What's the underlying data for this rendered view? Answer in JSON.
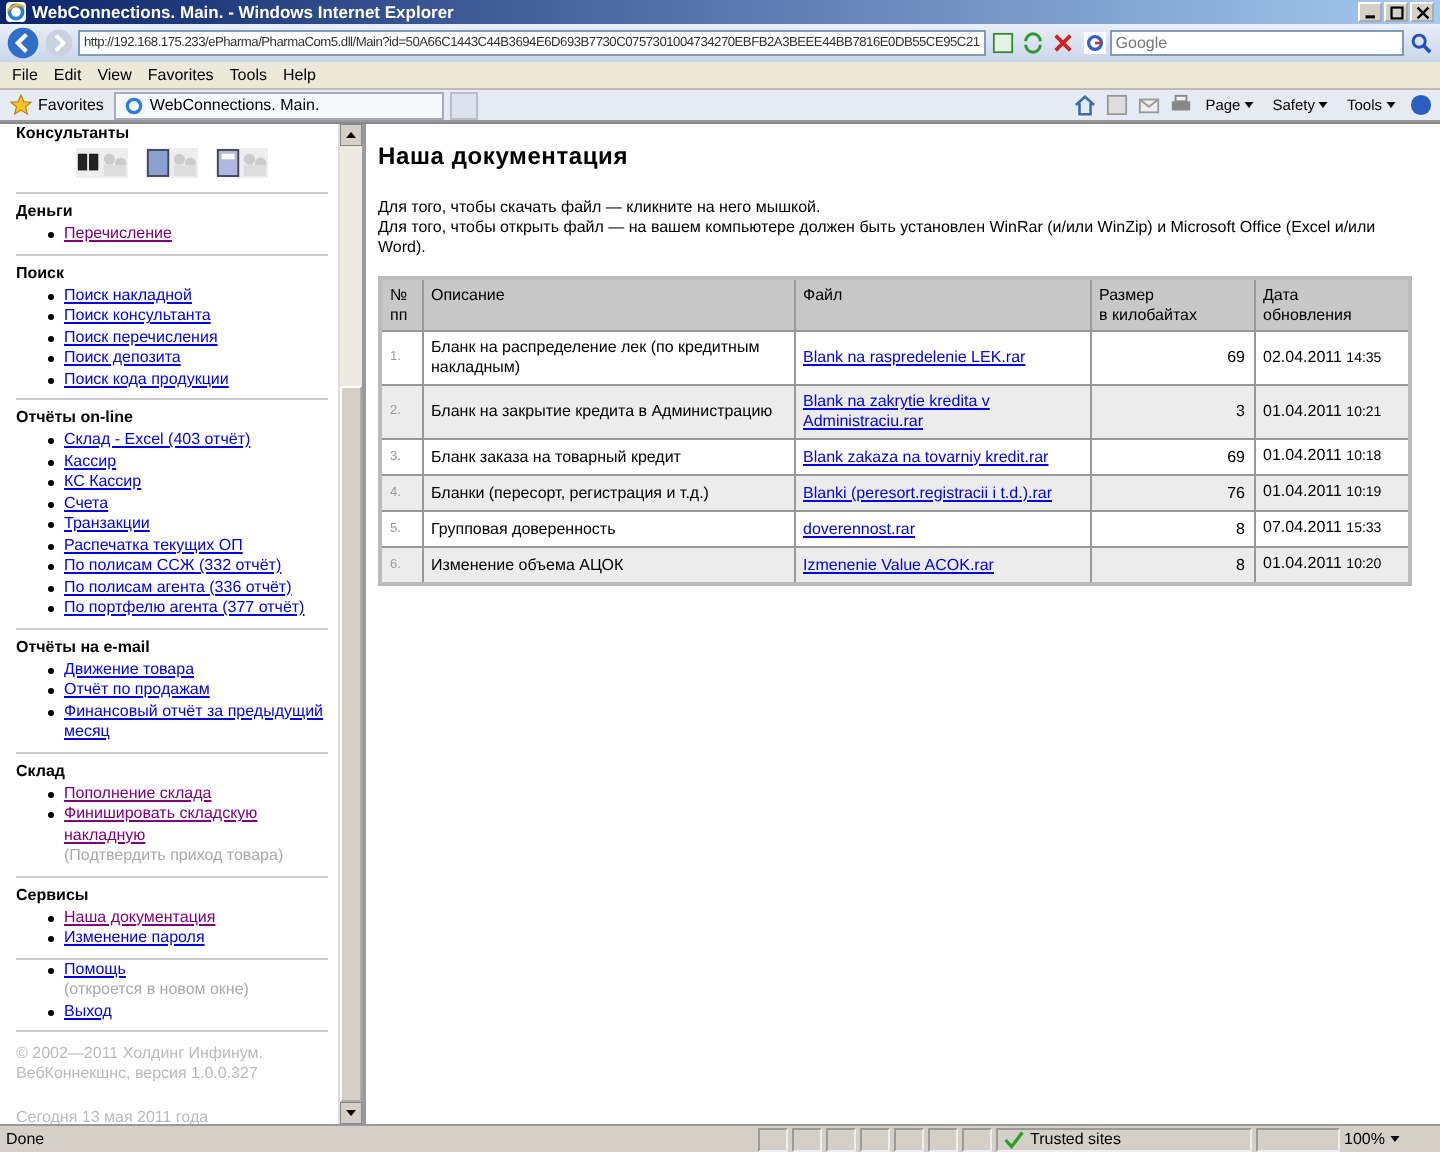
{
  "window": {
    "title": "WebConnections. Main. - Windows Internet Explorer"
  },
  "address_bar": {
    "url": "http://192.168.175.233/ePharma/PharmaCom5.dll/Main?id=50A66C1443C44B3694E6D693B7730C0757301004734270EBFB2A3BEEE44BB7816E0DB55CE95C21",
    "search_placeholder": "Google"
  },
  "menu": [
    "File",
    "Edit",
    "View",
    "Favorites",
    "Tools",
    "Help"
  ],
  "favorites_bar": {
    "favorites": "Favorites",
    "tab": "WebConnections. Main.",
    "commands": [
      "Page",
      "Safety",
      "Tools"
    ]
  },
  "sidebar": {
    "sections": [
      {
        "title": "Консультанты",
        "kind": "icons"
      },
      {
        "title": "Деньги",
        "kind": "links",
        "items": [
          {
            "label": "Перечисление",
            "visited": true
          }
        ]
      },
      {
        "title": "Поиск",
        "kind": "links",
        "items": [
          {
            "label": "Поиск накладной",
            "visited": false
          },
          {
            "label": "Поиск консультанта",
            "visited": false
          },
          {
            "label": "Поиск перечисления",
            "visited": false
          },
          {
            "label": "Поиск депозита",
            "visited": false
          },
          {
            "label": "Поиск кода продукции",
            "visited": false
          }
        ]
      },
      {
        "title": "Отчёты on-line",
        "kind": "links",
        "items": [
          {
            "label": "Склад - Excel (403 отчёт)",
            "visited": false
          },
          {
            "label": "Кассир",
            "visited": false
          },
          {
            "label": "КС Кассир",
            "visited": false
          },
          {
            "label": "Счета",
            "visited": false
          },
          {
            "label": "Транзакции",
            "visited": false
          },
          {
            "label": "Распечатка текущих ОП",
            "visited": false
          },
          {
            "label": "По полисам ССЖ (332 отчёт)",
            "visited": false
          },
          {
            "label": "По полисам агента (336 отчёт)",
            "visited": false
          },
          {
            "label": "По портфелю агента (377 отчёт)",
            "visited": false
          }
        ]
      },
      {
        "title": "Отчёты на e-mail",
        "kind": "links",
        "items": [
          {
            "label": "Движение товара",
            "visited": false
          },
          {
            "label": "Отчёт по продажам",
            "visited": false
          },
          {
            "label": "Финансовый отчёт за предыдущий месяц",
            "visited": false
          }
        ]
      },
      {
        "title": "Склад",
        "kind": "links",
        "items": [
          {
            "label": "Пополнение склада",
            "visited": true
          },
          {
            "label": "Финишировать складскую накладную",
            "visited": true,
            "note": "(Подтвердить приход товара)"
          }
        ]
      },
      {
        "title": "Сервисы",
        "kind": "links",
        "items": [
          {
            "label": "Наша документация",
            "visited": true
          },
          {
            "label": "Изменение пароля",
            "visited": false
          }
        ]
      },
      {
        "kind": "links",
        "items": [
          {
            "label": "Помощь",
            "visited": false,
            "note": "(откроется в новом окне)"
          },
          {
            "label": "Выход",
            "visited": false
          }
        ]
      }
    ],
    "copyright": "© 2002—2011 Холдинг Инфинум. ВебКоннекшнс, версия 1.0.0.327",
    "today": "Сегодня 13 мая 2011 года"
  },
  "main": {
    "title": "Наша документация",
    "intro": [
      "Для того, чтобы скачать файл — кликните на него мышкой.",
      "Для того, чтобы открыть файл — на вашем компьютере должен быть установлен WinRar (и/или WinZip) и Microsoft Office (Excel и/или Word)."
    ],
    "table": {
      "columns": [
        "№\nпп",
        "Описание",
        "Файл",
        "Размер\nв килобайтах",
        "Дата\nобновления"
      ],
      "rows": [
        {
          "num": "1.",
          "description": "Бланк на распределение лек (по кредитным накладным)",
          "file": "Blank na raspredelenie LEK.rar",
          "size": "69",
          "date": "02.04.2011",
          "time": "14:35"
        },
        {
          "num": "2.",
          "description": "Бланк на закрытие кредита в Администрацию",
          "file": "Blank na zakrytie kredita v Administraciu.rar",
          "size": "3",
          "date": "01.04.2011",
          "time": "10:21"
        },
        {
          "num": "3.",
          "description": "Бланк заказа на товарный кредит",
          "file": "Blank zakaza na tovarniy kredit.rar",
          "size": "69",
          "date": "01.04.2011",
          "time": "10:18"
        },
        {
          "num": "4.",
          "description": "Бланки (пересорт, регистрация и т.д.)",
          "file": "Blanki (peresort.registracii i t.d.).rar",
          "size": "76",
          "date": "01.04.2011",
          "time": "10:19"
        },
        {
          "num": "5.",
          "description": "Групповая доверенность",
          "file": "doverennost.rar",
          "size": "8",
          "date": "07.04.2011",
          "time": "15:33"
        },
        {
          "num": "6.",
          "description": "Изменение объема АЦОК",
          "file": "Izmenenie Value ACOK.rar",
          "size": "8",
          "date": "01.04.2011",
          "time": "10:20"
        }
      ]
    }
  },
  "status_bar": {
    "status": "Done",
    "zone": "Trusted sites",
    "zoom": "100%"
  }
}
